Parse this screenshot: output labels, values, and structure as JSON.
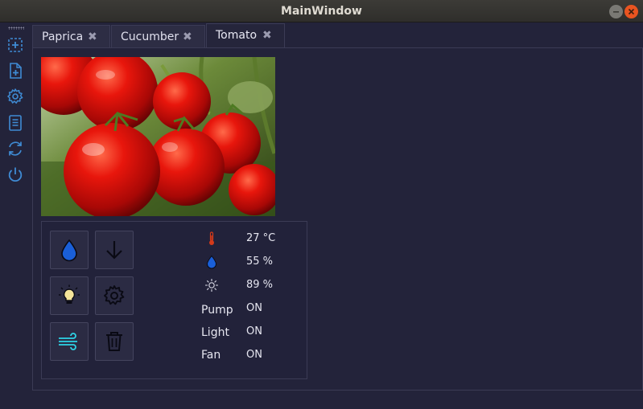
{
  "window": {
    "title": "MainWindow"
  },
  "sidebar": {
    "items": [
      {
        "name": "add-plant",
        "icon": "plus-square-icon"
      },
      {
        "name": "new-file",
        "icon": "file-plus-icon"
      },
      {
        "name": "settings",
        "icon": "gear-icon"
      },
      {
        "name": "log",
        "icon": "document-list-icon"
      },
      {
        "name": "refresh",
        "icon": "refresh-icon"
      },
      {
        "name": "power",
        "icon": "power-icon"
      }
    ]
  },
  "tabs": [
    {
      "label": "Paprica",
      "active": false
    },
    {
      "label": "Cucumber",
      "active": false
    },
    {
      "label": "Tomato",
      "active": true
    }
  ],
  "tab_close_glyph": "✖",
  "plant": {
    "image": "tomato-photo",
    "readings": {
      "temperature": "27 °C",
      "humidity": "55 %",
      "light_level": "89 %"
    },
    "states": [
      {
        "label": "Pump",
        "value": "ON"
      },
      {
        "label": "Light",
        "value": "ON"
      },
      {
        "label": "Fan",
        "value": "ON"
      }
    ]
  },
  "colors": {
    "accent": "#3f8bd4",
    "water": "#1a5fd8",
    "fan": "#2dd3e6",
    "bulb": "#f4e49a",
    "thermometer": "#d43a1a"
  }
}
